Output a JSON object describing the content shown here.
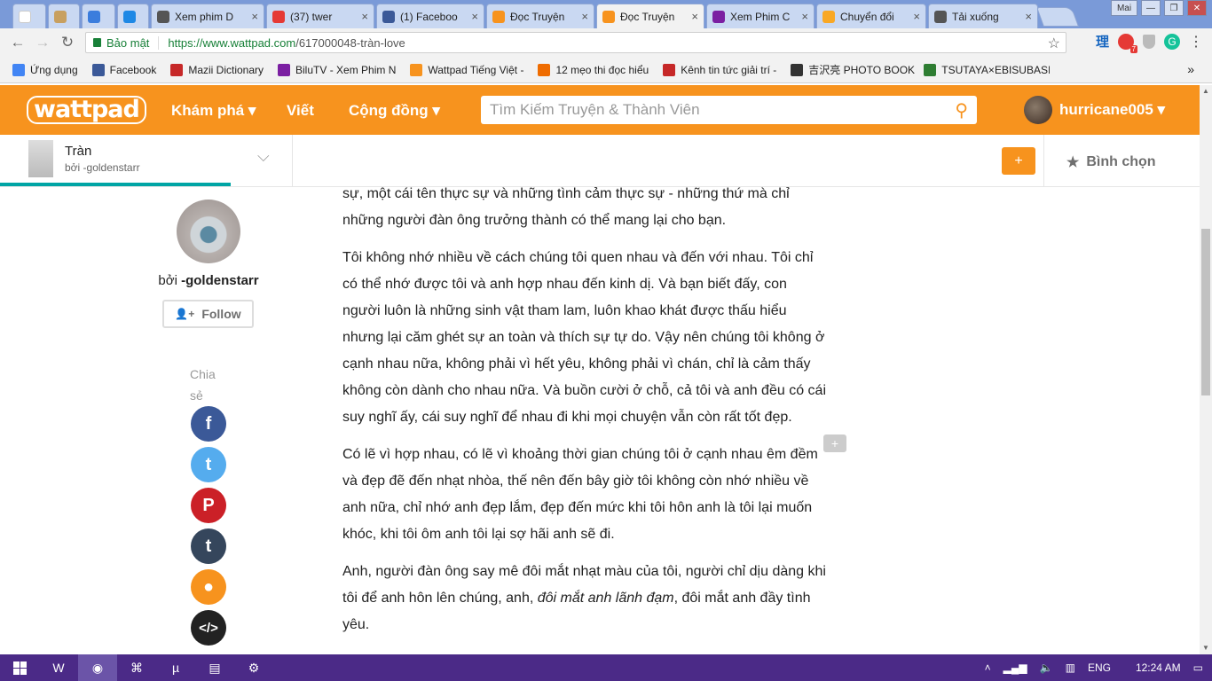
{
  "browser": {
    "tabs": [
      {
        "title": "",
        "icon": "google-icon",
        "color": "#ffffff"
      },
      {
        "title": "",
        "icon": "anime-icon",
        "color": "#c8a060"
      },
      {
        "title": "",
        "icon": "window-icon",
        "color": "#3b7ddd"
      },
      {
        "title": "",
        "icon": "compass-icon",
        "color": "#1e88e5"
      },
      {
        "title": "Xem phim D",
        "icon": "film-icon",
        "color": "#555555"
      },
      {
        "title": "(37) twer",
        "icon": "youtube-icon",
        "color": "#e53935"
      },
      {
        "title": "(1) Faceboo",
        "icon": "facebook-icon",
        "color": "#3b5998"
      },
      {
        "title": "Đọc Truyện",
        "icon": "wattpad-icon",
        "color": "#f7931e"
      },
      {
        "title": "Đọc Truyện",
        "icon": "wattpad-icon",
        "color": "#f7931e"
      },
      {
        "title": "Xem Phim C",
        "icon": "film-purple-icon",
        "color": "#7b1fa2"
      },
      {
        "title": "Chuyển đổi",
        "icon": "convert-icon",
        "color": "#f9a825"
      },
      {
        "title": "Tải xuống",
        "icon": "download-icon",
        "color": "#555555"
      }
    ],
    "profile_label": "Mai",
    "secure_label": "Bảo mật",
    "url_host": "https://www.wattpad.com",
    "url_path": "/617000048-tràn-love",
    "ext_label": "理",
    "ext_badge": "7",
    "bookmarks": [
      {
        "label": "Ứng dụng",
        "icon": "apps-icon",
        "color": "#4285f4"
      },
      {
        "label": "Facebook",
        "icon": "facebook-icon",
        "color": "#3b5998"
      },
      {
        "label": "Mazii Dictionary",
        "icon": "search-icon",
        "color": "#c62828"
      },
      {
        "label": "BiluTV - Xem Phim N",
        "icon": "film-purple-icon",
        "color": "#7b1fa2"
      },
      {
        "label": "Wattpad Tiếng Việt -",
        "icon": "wattpad-icon",
        "color": "#f7931e"
      },
      {
        "label": "12 mẹo thi đọc hiểu",
        "icon": "lightbulb-icon",
        "color": "#ef6c00"
      },
      {
        "label": "Kênh tin tức giải trí -",
        "icon": "news-icon",
        "color": "#c62828"
      },
      {
        "label": "吉沢亮 PHOTO BOOK",
        "icon": "book-icon",
        "color": "#333333"
      },
      {
        "label": "TSUTAYA×EBISUBASI",
        "icon": "store-icon",
        "color": "#2e7d32"
      }
    ],
    "more_label": "»"
  },
  "wattpad": {
    "logo": "wattpad",
    "nav": {
      "discover": "Khám phá ▾",
      "write": "Viết",
      "community": "Cộng đồng ▾"
    },
    "search_placeholder": "Tìm Kiếm Truyện & Thành Viên",
    "username": "hurricane005 ▾",
    "accent": "#f7931e"
  },
  "story": {
    "title": "Tràn",
    "by": "bởi -goldenstarr",
    "add_label": "+",
    "vote_label": "Bình chọn",
    "reading_progress": 0.19
  },
  "author": {
    "by_prefix": "bởi ",
    "name": "-goldenstarr",
    "follow_label": "Follow",
    "share_label": "Chia sẻ"
  },
  "share_buttons": [
    {
      "name": "facebook-share-button",
      "glyph": "f",
      "color": "#3b5998"
    },
    {
      "name": "twitter-share-button",
      "glyph": "t",
      "color": "#55acee"
    },
    {
      "name": "pinterest-share-button",
      "glyph": "P",
      "color": "#cb2027"
    },
    {
      "name": "tumblr-share-button",
      "glyph": "t",
      "color": "#35465c"
    },
    {
      "name": "profile-share-button",
      "glyph": "●",
      "color": "#f7931e"
    },
    {
      "name": "embed-share-button",
      "glyph": "</>",
      "color": "#222222"
    }
  ],
  "article": {
    "p0": "sự, một cái tên thực sự và những tình cảm thực sự - những thứ mà chỉ những người đàn ông trưởng thành có thể mang lại cho bạn.",
    "p1": "Tôi không nhớ nhiều về cách chúng tôi quen nhau và đến với nhau. Tôi chỉ có thể nhớ được tôi và anh hợp nhau đến kinh dị. Và bạn biết đấy, con người luôn là những sinh vật tham lam, luôn khao khát được thấu hiểu nhưng lại căm ghét sự an toàn và thích sự tự do. Vậy nên chúng tôi không ở cạnh nhau nữa, không phải vì hết yêu, không phải vì chán, chỉ là cảm thấy không còn dành cho nhau nữa. Và buồn cười ở chỗ, cả tôi và anh đều có cái suy nghĩ ấy, cái suy nghĩ để nhau đi khi mọi chuyện vẫn còn rất tốt đẹp.",
    "p2": "Có lẽ vì hợp nhau, có lẽ vì khoảng thời gian chúng tôi ở cạnh nhau êm đềm và đẹp đẽ đến nhạt nhòa, thế nên đến bây giờ tôi không còn nhớ nhiều về anh nữa, chỉ nhớ anh đẹp lắm, đẹp đến mức khi tôi hôn anh là tôi lại muốn khóc, khi tôi ôm anh tôi lại sợ hãi anh sẽ đi.",
    "p3_a": "Anh, người đàn ông say mê đôi mắt nhạt màu của tôi, người chỉ dịu dàng khi tôi để anh hôn lên chúng, anh, ",
    "p3_em": "đôi mắt anh lãnh đạm",
    "p3_b": ", đôi mắt anh đầy tình yêu."
  },
  "comment_badge": "+",
  "taskbar": {
    "apps": [
      "W",
      "◉",
      "⌘",
      "µ",
      "▤",
      "⚙"
    ],
    "lang": "ENG",
    "time": "12:24 AM"
  }
}
